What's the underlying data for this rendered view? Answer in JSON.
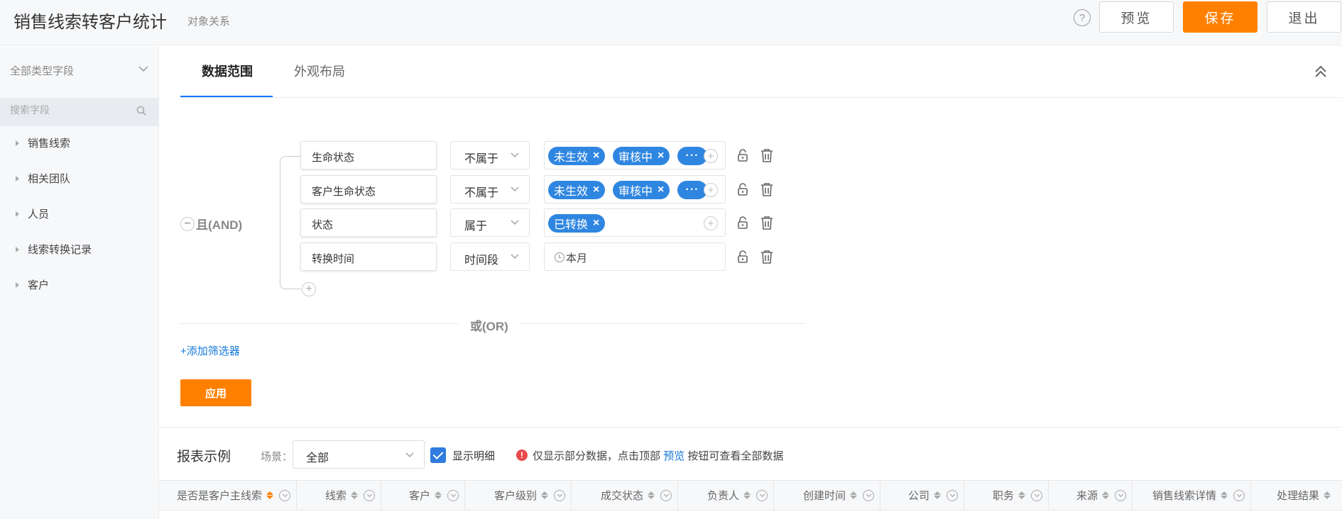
{
  "header": {
    "title": "销售线索转客户统计",
    "subtitle": "对象关系",
    "help_icon": "?",
    "preview_label": "预览",
    "save_label": "保存",
    "exit_label": "退出",
    "accent_color": "#ff8000"
  },
  "sidebar": {
    "type_select": "全部类型字段",
    "search_placeholder": "搜索字段",
    "items": [
      {
        "label": "销售线索"
      },
      {
        "label": "相关团队"
      },
      {
        "label": "人员"
      },
      {
        "label": "线索转换记录"
      },
      {
        "label": "客户"
      }
    ]
  },
  "tabs": [
    {
      "label": "数据范围",
      "active": true
    },
    {
      "label": "外观布局",
      "active": false
    }
  ],
  "filters": {
    "group_label": "且(AND)",
    "rows": [
      {
        "field": "生命状态",
        "operator": "不属于",
        "tags": [
          "未生效",
          "审核中"
        ],
        "more": "···"
      },
      {
        "field": "客户生命状态",
        "operator": "不属于",
        "tags": [
          "未生效",
          "审核中"
        ],
        "more": "···"
      },
      {
        "field": "状态",
        "operator": "属于",
        "tags": [
          "已转换"
        ]
      },
      {
        "field": "转换时间",
        "operator": "时间段",
        "time_value": "本月"
      }
    ],
    "or_label": "或(OR)",
    "add_filter_label": "+添加筛选器",
    "apply_label": "应用",
    "tag_color": "#2f86e0"
  },
  "report": {
    "title": "报表示例",
    "scene_label": "场景：",
    "scene_value": "全部",
    "show_detail_label": "显示明细",
    "show_detail_checked": true,
    "notice_before": "仅显示部分数据，点击顶部",
    "notice_link": "预览",
    "notice_after": "按钮可查看全部数据",
    "columns": [
      {
        "label": "是否是客户主线索",
        "sorted": "asc"
      },
      {
        "label": "线索"
      },
      {
        "label": "客户"
      },
      {
        "label": "客户级别"
      },
      {
        "label": "成交状态"
      },
      {
        "label": "负责人"
      },
      {
        "label": "创建时间"
      },
      {
        "label": "公司"
      },
      {
        "label": "职务"
      },
      {
        "label": "来源"
      },
      {
        "label": "销售线索详情"
      },
      {
        "label": "处理结果"
      }
    ]
  }
}
